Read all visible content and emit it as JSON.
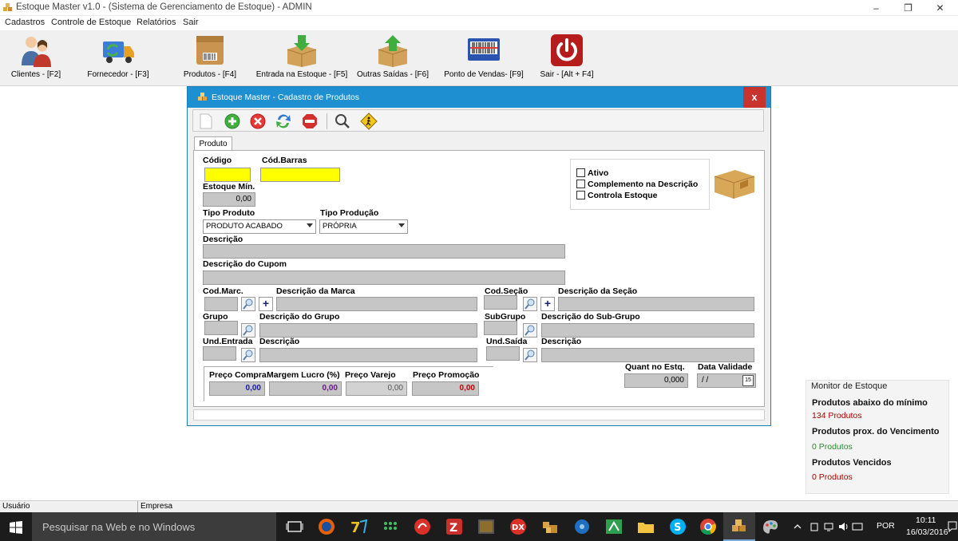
{
  "window": {
    "title": "Estoque Master v1.0 - (Sistema de Gerenciamento de Estoque) - ADMIN",
    "minimize": "–",
    "maximize": "❐",
    "close": "✕"
  },
  "menu": [
    "Cadastros",
    "Controle de Estoque",
    "Relatórios",
    "Sair"
  ],
  "toolbar": [
    {
      "label": "Clientes - [F2]",
      "icon": "users-icon"
    },
    {
      "label": "Fornecedor - [F3]",
      "icon": "truck-icon"
    },
    {
      "label": "Produtos - [F4]",
      "icon": "product-box-icon"
    },
    {
      "label": "Entrada na Estoque - [F5]",
      "icon": "box-in-icon"
    },
    {
      "label": "Outras Saídas - [F6]",
      "icon": "box-out-icon"
    },
    {
      "label": "Ponto de Vendas- [F9]",
      "icon": "barcode-reader-icon"
    },
    {
      "label": "Sair - [Alt + F4]",
      "icon": "power-icon"
    }
  ],
  "dialog": {
    "title": "Estoque Master - Cadastro de Produtos",
    "close": "x",
    "tab": "Produto",
    "labels": {
      "codigo": "Código",
      "cod_barras": "Cód.Barras",
      "estoque_min": "Estoque Mín.",
      "tipo_produto": "Tipo Produto",
      "tipo_producao": "Tipo Produção",
      "descricao": "Descrição",
      "descricao_cupom": "Descrição do Cupom",
      "cod_marc": "Cod.Marc.",
      "descricao_marca": "Descrição da Marca",
      "cod_secao": "Cod.Seção",
      "descricao_secao": "Descrição da Seção",
      "grupo": "Grupo",
      "descricao_grupo": "Descrição do Grupo",
      "subgrupo": "SubGrupo",
      "descricao_subgrupo": "Descrição do Sub-Grupo",
      "und_entrada": "Und.Entrada",
      "descricao_entrada": "Descrição",
      "und_saida": "Und.Saída",
      "descricao_saida": "Descrição",
      "preco_compra": "Preço Compra",
      "margem_lucro": "Margem Lucro (%)",
      "preco_varejo": "Preço Varejo",
      "preco_promocao": "Preço Promoção",
      "quant_estq": "Quant no Estq.",
      "data_validade": "Data Validade"
    },
    "values": {
      "estoque_min": "0,00",
      "tipo_produto": "PRODUTO ACABADO",
      "tipo_producao": "PRÓPRIA",
      "preco_compra": "0,00",
      "margem_lucro": "0,00",
      "preco_varejo": "0,00",
      "preco_promocao": "0,00",
      "quant_estq": "0,000",
      "data_validade": " / /",
      "calendar": "15"
    },
    "checkboxes": [
      {
        "label": "Ativo",
        "checked": false
      },
      {
        "label": "Complemento na Descrição",
        "checked": false
      },
      {
        "label": "Controla Estoque",
        "checked": false
      }
    ],
    "price_colors": {
      "preco_compra": "#1a1aa0",
      "margem_lucro": "#6a1a8a",
      "preco_varejo": "#555555",
      "preco_promocao": "#c00000"
    }
  },
  "monitor": {
    "title": "Monitor de Estoque",
    "items": [
      {
        "label": "Produtos abaixo do mínimo",
        "value": "134 Produtos",
        "color": "#b00000"
      },
      {
        "label": "Produtos prox. do Vencimento",
        "value": "0 Produtos",
        "color": "#2e8b2e"
      },
      {
        "label": "Produtos Vencidos",
        "value": "0 Produtos",
        "color": "#b00000"
      }
    ]
  },
  "status": {
    "usuario": "Usuário",
    "empresa": "Empresa"
  },
  "taskbar": {
    "search_placeholder": "Pesquisar na Web e no Windows",
    "language": "POR",
    "time": "10:11",
    "date": "16/03/2016"
  }
}
